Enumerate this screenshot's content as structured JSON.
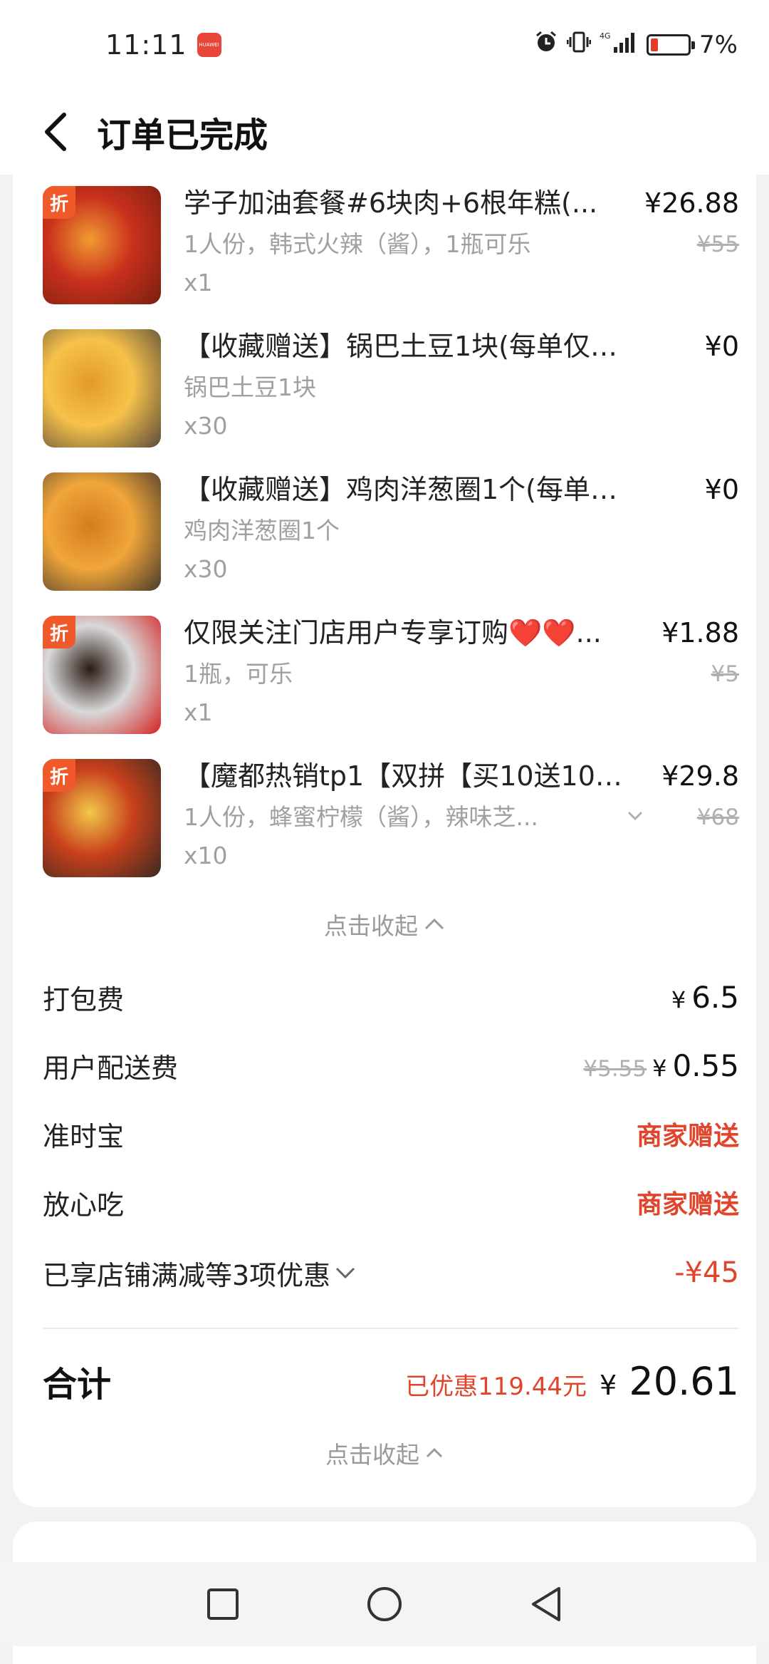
{
  "status_bar": {
    "time": "11:11",
    "app_badge": "HUAWEI",
    "network": "4G",
    "battery_percent": "7%",
    "battery_level": 0.07
  },
  "header": {
    "title": "订单已完成"
  },
  "items": [
    {
      "name": "学子加油套餐#6块肉+6根年糕(...",
      "spec": "1人份，韩式火辣（酱），1瓶可乐",
      "qty": "x1",
      "price": "¥26.88",
      "orig_price": "¥55",
      "badge": "折",
      "thumb_colors": [
        "#c8301c",
        "#f29a33",
        "#7a1f10"
      ]
    },
    {
      "name": "【收藏赠送】锅巴土豆1块(每单仅限...",
      "spec": "锅巴土豆1块",
      "qty": "x30",
      "price": "¥0",
      "orig_price": "",
      "badge": "",
      "thumb_colors": [
        "#f6c24a",
        "#e39a2a",
        "#5a4a3a"
      ]
    },
    {
      "name": "【收藏赠送】鸡肉洋葱圈1个(每单仅...",
      "spec": "鸡肉洋葱圈1个",
      "qty": "x30",
      "price": "¥0",
      "orig_price": "",
      "badge": "",
      "thumb_colors": [
        "#f0a63a",
        "#d57d1e",
        "#4a3a2a"
      ]
    },
    {
      "name": "仅限关注门店用户专享订购❤️❤️...",
      "spec": "1瓶，可乐",
      "qty": "x1",
      "price": "¥1.88",
      "orig_price": "¥5",
      "badge": "折",
      "thumb_colors": [
        "#d9d9d9",
        "#2a1a14",
        "#d32222"
      ]
    },
    {
      "name": "【魔都热销tp1【双拼【买10送10】...",
      "spec": "1人份，蜂蜜柠檬（酱），辣味芝...",
      "qty": "x10",
      "price": "¥29.8",
      "orig_price": "¥68",
      "badge": "折",
      "thumb_colors": [
        "#c8401c",
        "#f2c84a",
        "#3a2a20"
      ]
    }
  ],
  "collapse_label": "点击收起",
  "fees": {
    "packing_label": "打包费",
    "packing_currency": "¥",
    "packing_value": "6.5",
    "delivery_label": "用户配送费",
    "delivery_orig": "¥5.55",
    "delivery_currency": "¥",
    "delivery_value": "0.55",
    "ontime_label": "准时宝",
    "ontime_value": "商家赠送",
    "safe_label": "放心吃",
    "safe_value": "商家赠送",
    "discount_label": "已享店铺满减等3项优惠",
    "discount_value": "-¥45"
  },
  "total": {
    "label": "合计",
    "saved": "已优惠119.44元",
    "currency": "¥",
    "value": "20.61"
  },
  "colors": {
    "accent_red": "#e0452c",
    "badge_orange": "#f05a2a"
  }
}
